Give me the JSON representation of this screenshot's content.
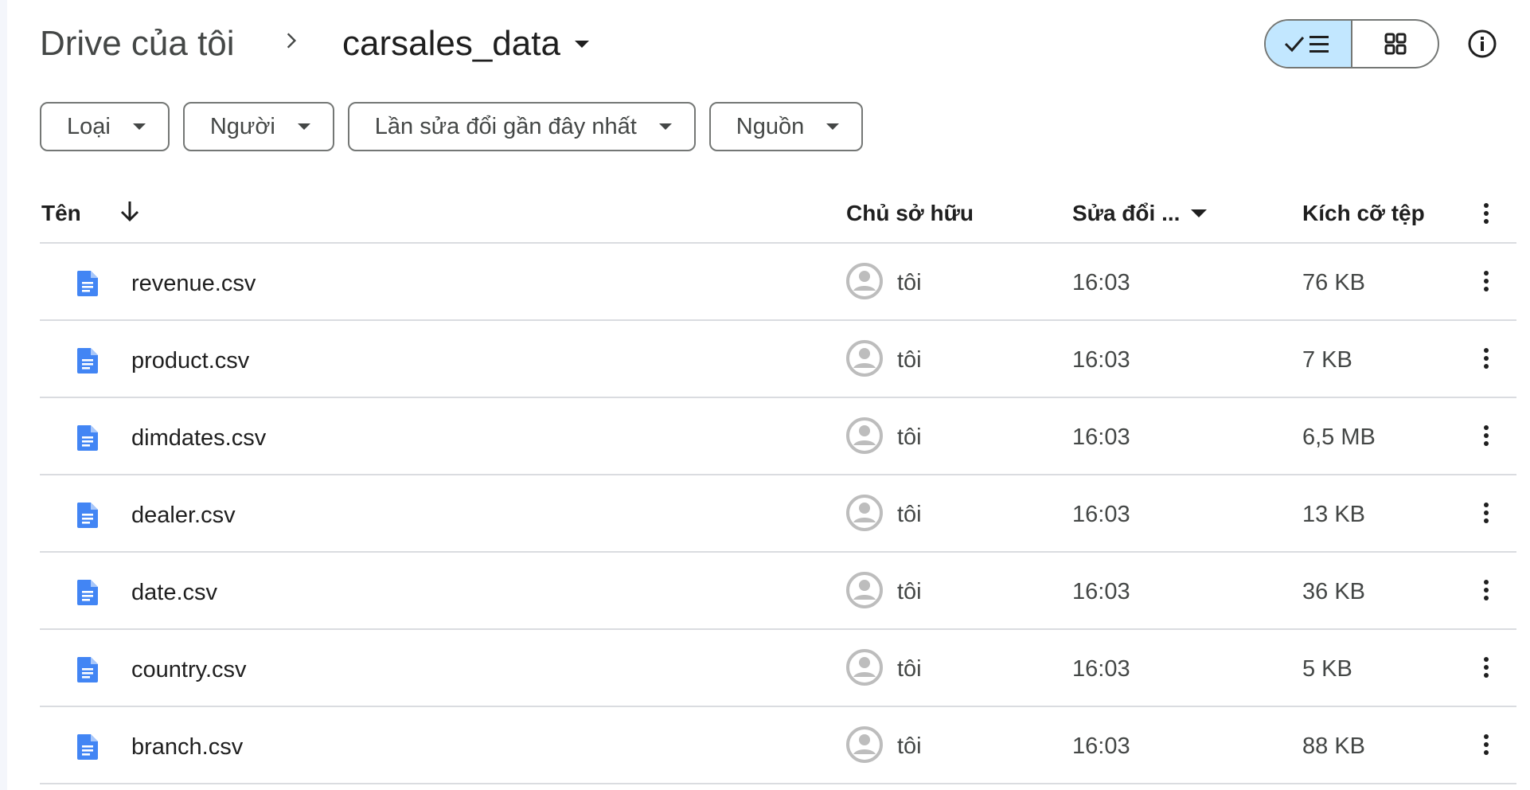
{
  "breadcrumb": {
    "root": "Drive của tôi",
    "current": "carsales_data"
  },
  "view": {
    "mode": "list"
  },
  "filters": [
    {
      "label": "Loại"
    },
    {
      "label": "Người"
    },
    {
      "label": "Lần sửa đổi gần đây nhất"
    },
    {
      "label": "Nguồn"
    }
  ],
  "table": {
    "headers": {
      "name": "Tên",
      "owner": "Chủ sở hữu",
      "modified": "Sửa đổi ...",
      "size": "Kích cỡ tệp"
    },
    "rows": [
      {
        "name": "revenue.csv",
        "owner": "tôi",
        "modified": "16:03",
        "size": "76 KB"
      },
      {
        "name": "product.csv",
        "owner": "tôi",
        "modified": "16:03",
        "size": "7 KB"
      },
      {
        "name": "dimdates.csv",
        "owner": "tôi",
        "modified": "16:03",
        "size": "6,5 MB"
      },
      {
        "name": "dealer.csv",
        "owner": "tôi",
        "modified": "16:03",
        "size": "13 KB"
      },
      {
        "name": "date.csv",
        "owner": "tôi",
        "modified": "16:03",
        "size": "36 KB"
      },
      {
        "name": "country.csv",
        "owner": "tôi",
        "modified": "16:03",
        "size": "5 KB"
      },
      {
        "name": "branch.csv",
        "owner": "tôi",
        "modified": "16:03",
        "size": "88 KB"
      }
    ]
  },
  "colors": {
    "accent": "#c2e7ff",
    "file_icon": "#4285f4",
    "border": "#747775",
    "divider": "#dadce0",
    "avatar": "#bdbdbd"
  },
  "icons": {
    "breadcrumb_separator": "chevron-right-icon",
    "list_view": "checkmark-list-icon",
    "grid_view": "grid-icon",
    "info": "info-icon",
    "sort": "arrow-down-icon",
    "file": "document-icon",
    "owner": "person-avatar-icon",
    "row_menu": "more-vert-icon"
  }
}
